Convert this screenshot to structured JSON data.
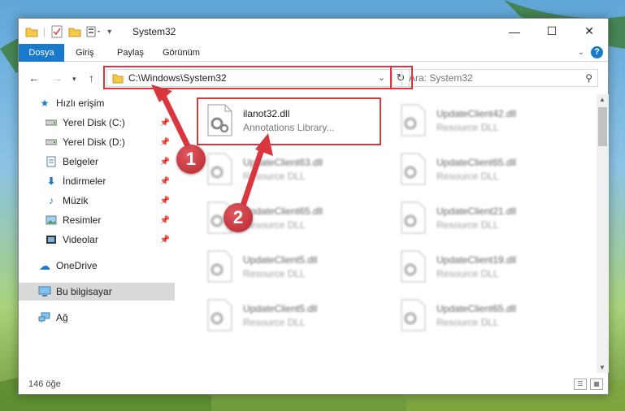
{
  "window": {
    "title": "System32"
  },
  "ribbon": {
    "tabs": [
      {
        "label": "Dosya",
        "active": true
      },
      {
        "label": "Giriş"
      },
      {
        "label": "Paylaş"
      },
      {
        "label": "Görünüm"
      }
    ],
    "help_label": "?"
  },
  "address": {
    "path": "C:\\Windows\\System32"
  },
  "search": {
    "placeholder": "Ara: System32"
  },
  "sidebar": {
    "items": [
      {
        "label": "Hızlı erişim",
        "icon": "star-icon"
      },
      {
        "label": "Yerel Disk (C:)",
        "icon": "drive-icon",
        "pinned": true
      },
      {
        "label": "Yerel Disk (D:)",
        "icon": "drive-icon",
        "pinned": true
      },
      {
        "label": "Belgeler",
        "icon": "documents-icon",
        "pinned": true
      },
      {
        "label": "İndirmeler",
        "icon": "download-icon",
        "pinned": true
      },
      {
        "label": "Müzik",
        "icon": "music-icon",
        "pinned": true
      },
      {
        "label": "Resimler",
        "icon": "pictures-icon",
        "pinned": true
      },
      {
        "label": "Videolar",
        "icon": "videos-icon",
        "pinned": true
      },
      {
        "label": "OneDrive",
        "icon": "cloud-icon"
      },
      {
        "label": "Bu bilgisayar",
        "icon": "computer-icon",
        "selected": true
      },
      {
        "label": "Ağ",
        "icon": "network-icon"
      }
    ]
  },
  "files": [
    {
      "name": "ilanot32.dll",
      "desc": "Annotations Library...",
      "highlight": true
    },
    {
      "name": "UpdateClient42.dll",
      "desc": "Resource DLL"
    },
    {
      "name": "UpdateClient63.dll",
      "desc": "Resource DLL"
    },
    {
      "name": "UpdateClient65.dll",
      "desc": "Resource DLL"
    },
    {
      "name": "UpdateClient65.dll",
      "desc": "Resource DLL"
    },
    {
      "name": "UpdateClient21.dll",
      "desc": "Resource DLL"
    },
    {
      "name": "UpdateClient5.dll",
      "desc": "Resource DLL"
    },
    {
      "name": "UpdateClient19.dll",
      "desc": "Resource DLL"
    },
    {
      "name": "UpdateClient5.dll",
      "desc": "Resource DLL"
    },
    {
      "name": "UpdateClient65.dll",
      "desc": "Resource DLL"
    }
  ],
  "status": {
    "count": "146 öğe"
  },
  "annotations": {
    "marker1": "1",
    "marker2": "2"
  },
  "colors": {
    "accent": "#1979ca",
    "highlight": "#d9363e",
    "selected": "#d9d9d9"
  }
}
